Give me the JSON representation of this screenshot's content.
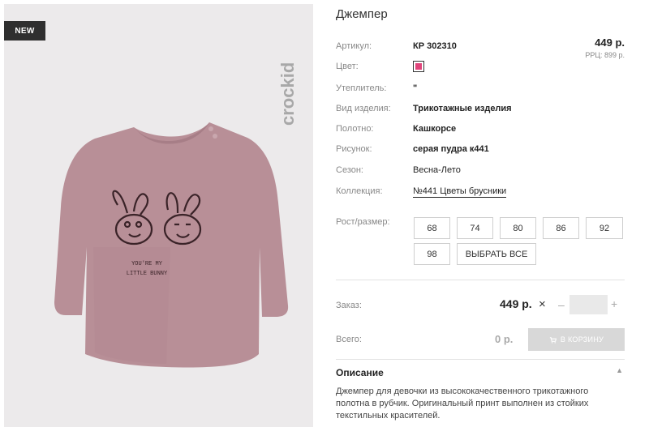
{
  "product": {
    "badge": "NEW",
    "brand": "crockid",
    "print_text_line1": "YOU'RE MY",
    "print_text_line2": "LITTLE BUNNY",
    "title": "Джемпер",
    "price": "449 р.",
    "rrp": "РРЦ: 899 р."
  },
  "attributes": [
    {
      "label": "Артикул:",
      "value": "КР 302310"
    },
    {
      "label": "Цвет:",
      "value": ""
    },
    {
      "label": "Утеплитель:",
      "value": "\""
    },
    {
      "label": "Вид изделия:",
      "value": "Трикотажные изделия"
    },
    {
      "label": "Полотно:",
      "value": "Кашкорсе"
    },
    {
      "label": "Рисунок:",
      "value": "серая пудра к441"
    },
    {
      "label": "Сезон:",
      "value": "Весна-Лето"
    },
    {
      "label": "Коллекция:",
      "value": "№441 Цветы брусники"
    }
  ],
  "color_swatch": "#e0457b",
  "sizes": {
    "label": "Рост/размер:",
    "options": [
      "68",
      "74",
      "80",
      "86",
      "92",
      "98"
    ],
    "select_all": "ВЫБРАТЬ ВСЕ"
  },
  "order": {
    "label": "Заказ:",
    "price": "449 р.",
    "times": "×",
    "minus": "–",
    "plus": "+",
    "quantity": ""
  },
  "total": {
    "label": "Всего:",
    "value": "0 р.",
    "cart_button": "В КОРЗИНУ"
  },
  "description": {
    "title": "Описание",
    "text": "Джемпер для девочки из высококачественного трикотажного полотна в рубчик. Оригинальный принт выполнен из стойких текстильных красителей."
  }
}
